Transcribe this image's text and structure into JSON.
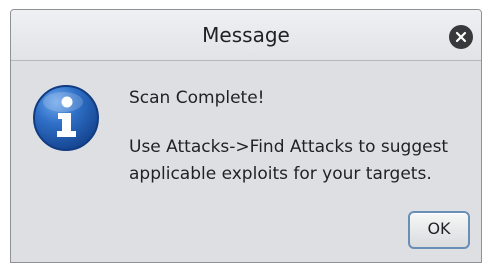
{
  "dialog": {
    "title": "Message",
    "close_icon": "close-icon",
    "info_icon": "info-icon",
    "message": {
      "heading": "Scan Complete!",
      "line1": "Use Attacks->Find Attacks to suggest",
      "line2": "applicable exploits for your targets."
    },
    "ok_label": "OK",
    "colors": {
      "dialog_background": "#dddfe3",
      "title_text": "#202225",
      "info_icon_blue": "#1f5aa9",
      "button_border": "#6a8fb6"
    }
  }
}
